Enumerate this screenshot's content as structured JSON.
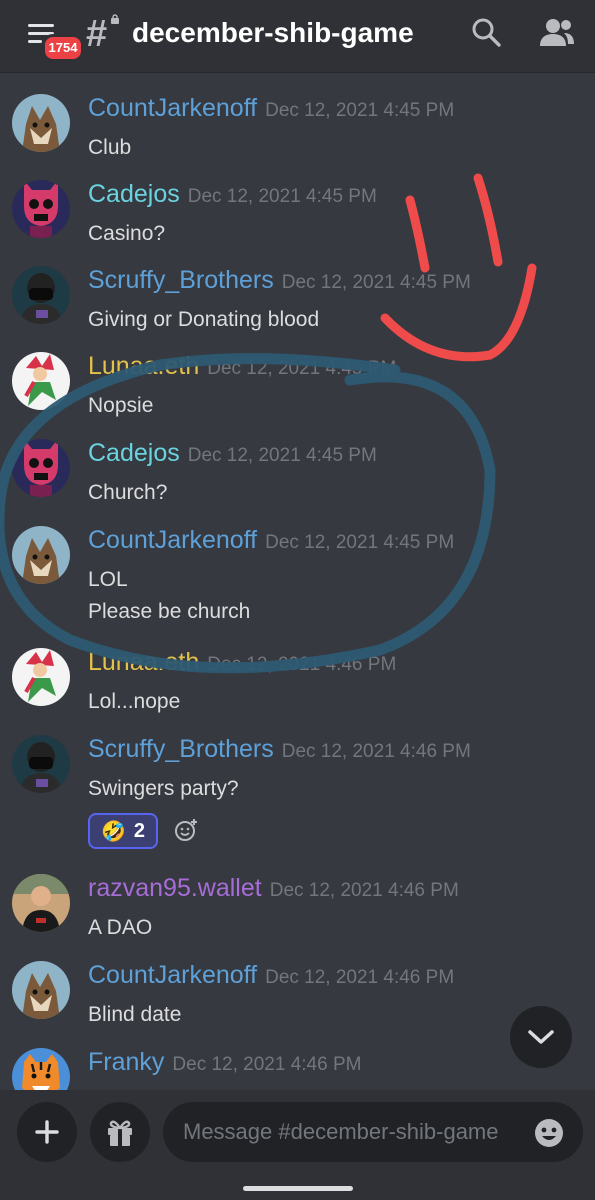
{
  "header": {
    "channel_name": "december-shib-game",
    "notification_count": "1754",
    "hash_glyph": "#"
  },
  "colors": {
    "background": "#36393f",
    "header": "#2f3136",
    "timestamp": "#72767d",
    "blue_role": "#5ea0d8",
    "teal_role": "#6ad3e0",
    "yellow_role": "#e2c24a",
    "purple_role": "#a76cd8",
    "red_annotation": "#f04b4b",
    "blue_annotation": "#2d5a73"
  },
  "messages": [
    {
      "username": "CountJarkenoff",
      "timestamp": "Dec 12, 2021 4:45 PM",
      "lines": [
        "Club"
      ],
      "color": "#5ea0d8",
      "avatar": "fox-avatar"
    },
    {
      "username": "Cadejos",
      "timestamp": "Dec 12, 2021 4:45 PM",
      "lines": [
        "Casino?"
      ],
      "color": "#6ad3e0",
      "avatar": "pink-skull-avatar"
    },
    {
      "username": "Scruffy_Brothers",
      "timestamp": "Dec 12, 2021 4:45 PM",
      "lines": [
        "Giving or Donating blood"
      ],
      "color": "#5ea0d8",
      "avatar": "masked-figure-avatar"
    },
    {
      "username": "Lunaa.eth",
      "timestamp": "Dec 12, 2021 4:45 PM",
      "lines": [
        "Nopsie"
      ],
      "color": "#e2c24a",
      "avatar": "jester-avatar"
    },
    {
      "username": "Cadejos",
      "timestamp": "Dec 12, 2021 4:45 PM",
      "lines": [
        "Church?"
      ],
      "color": "#6ad3e0",
      "avatar": "pink-skull-avatar"
    },
    {
      "username": "CountJarkenoff",
      "timestamp": "Dec 12, 2021 4:45 PM",
      "lines": [
        "LOL",
        "Please be church"
      ],
      "color": "#5ea0d8",
      "avatar": "fox-avatar"
    },
    {
      "username": "Lunaa.eth",
      "timestamp": "Dec 12, 2021 4:46 PM",
      "lines": [
        "Lol...nope"
      ],
      "color": "#e2c24a",
      "avatar": "jester-avatar"
    },
    {
      "username": "Scruffy_Brothers",
      "timestamp": "Dec 12, 2021 4:46 PM",
      "lines": [
        "Swingers party?"
      ],
      "color": "#5ea0d8",
      "avatar": "masked-figure-avatar"
    },
    {
      "username": "razvan95.wallet",
      "timestamp": "Dec 12, 2021 4:46 PM",
      "lines": [
        "A DAO"
      ],
      "color": "#a76cd8",
      "avatar": "man-photo-avatar"
    },
    {
      "username": "CountJarkenoff",
      "timestamp": "Dec 12, 2021 4:46 PM",
      "lines": [
        "Blind date"
      ],
      "color": "#5ea0d8",
      "avatar": "fox-avatar"
    },
    {
      "username": "Franky",
      "timestamp": "Dec 12, 2021 4:46 PM",
      "lines": [],
      "color": "#5ea0d8",
      "avatar": "tiger-avatar"
    }
  ],
  "reaction": {
    "emoji": "🤣",
    "count": "2",
    "icon": "rolling-laughing-emoji"
  },
  "composer": {
    "placeholder": "Message #december-shib-game"
  }
}
